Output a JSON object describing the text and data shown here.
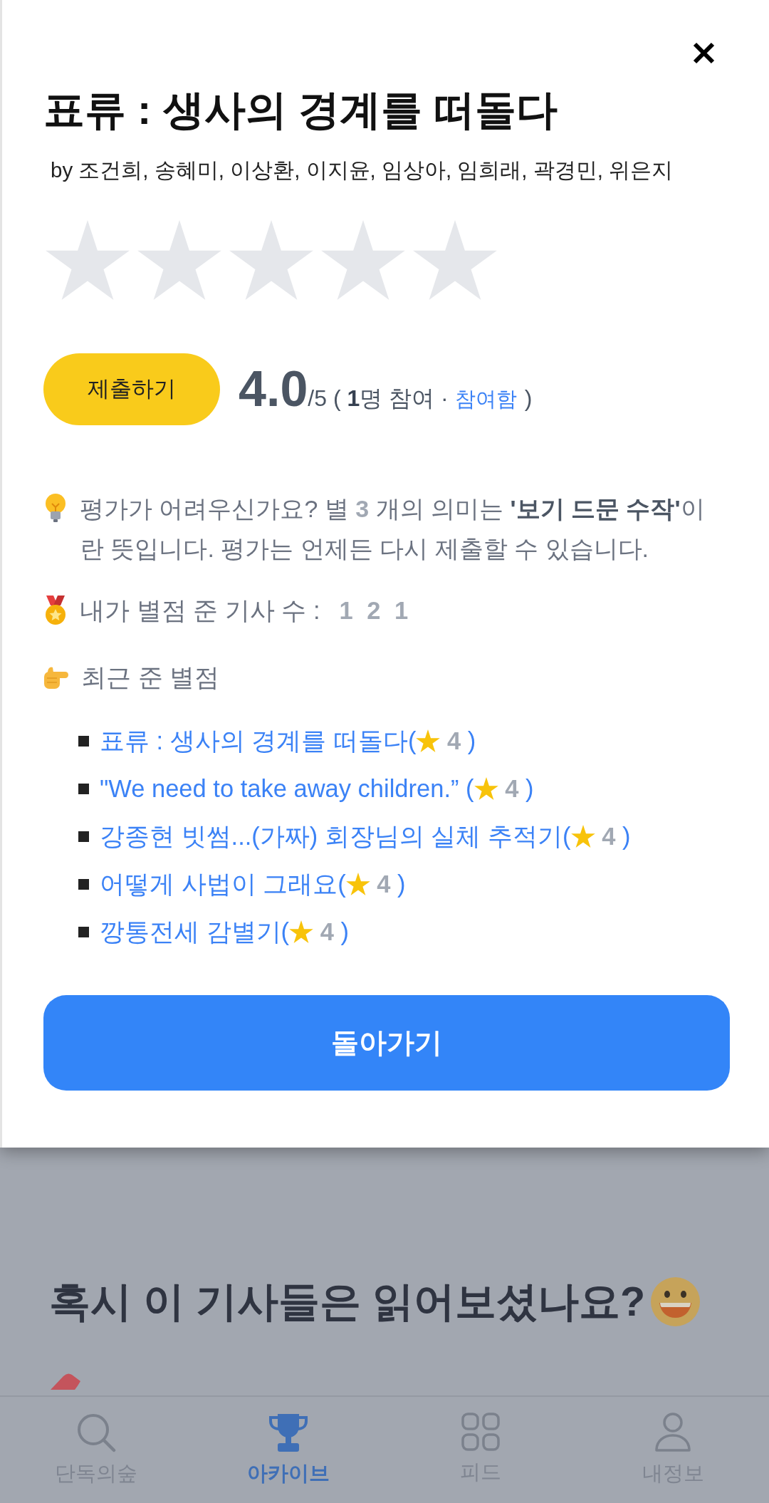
{
  "modal": {
    "title": "표류 : 생사의 경계를 떠돌다",
    "byline": "by 조건희, 송혜미, 이상환, 이지윤, 임상아, 임희래, 곽경민, 위은지",
    "rating_input": {
      "stars": 0
    },
    "submit_button": "제출하기",
    "average": {
      "score": "4.0",
      "summary": "/5 ( **1**명 참여 ·",
      "status": "참여함",
      "closing": ")"
    },
    "tip": "평가가 어려우신가요? 별 **3** 개의 의미는 **'보기 드문 수작'**이란 뜻입니다. 평가는 언제든 다시 제출할 수 있습니다.",
    "rated_count": {
      "label": "내가 별점 준 기사 수 :",
      "value": "1 2 1"
    },
    "recent_heading": "최근 준 별점",
    "recent_ratings": [
      {
        "title": "표류 : 생사의 경계를 떠돌다(",
        "rating": "4",
        "closing": ")"
      },
      {
        "title": "\"We need to take away children.” (",
        "rating": "4",
        "closing": ")"
      },
      {
        "title": "강종현 빗썸...(가짜) 회장님의 실체 추적기(",
        "rating": "4",
        "closing": ")"
      },
      {
        "title": "어떻게 사법이 그래요(",
        "rating": "4",
        "closing": ")"
      },
      {
        "title": "깡통전세 감별기(",
        "rating": "4",
        "closing": ")"
      }
    ],
    "back_button": "돌아가기"
  },
  "background": {
    "heading": "혹시 이 기사들은 읽어보셨나요?"
  },
  "bottom_nav": {
    "tabs": [
      {
        "label": "단독의숲",
        "selected": false
      },
      {
        "label": "아카이브",
        "selected": true
      },
      {
        "label": "피드",
        "selected": false
      },
      {
        "label": "내정보",
        "selected": false
      }
    ]
  }
}
